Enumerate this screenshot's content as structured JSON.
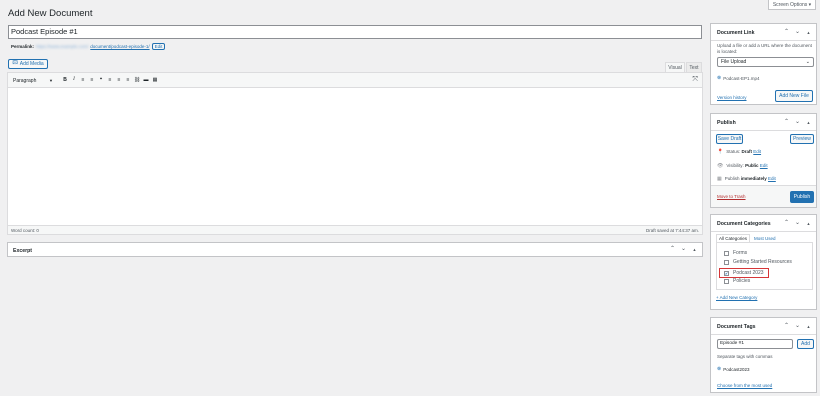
{
  "page_title": "Add New Document",
  "screen_options": "Screen Options ▾",
  "title_value": "Podcast Episode #1",
  "permalink": {
    "label": "Permalink:",
    "url_blur": "https://www.example.com/",
    "url_slug": "document/podcast-episode-1/",
    "edit": "Edit"
  },
  "editor": {
    "add_media": "Add Media",
    "tab_visual": "Visual",
    "tab_text": "Text",
    "format_select": "Paragraph",
    "toolbar": [
      "B",
      "I",
      "≡",
      "≡",
      "❝",
      "≡",
      "≡",
      "≡",
      "⛓",
      "▬",
      "▦"
    ],
    "word_count": "Word count: 0",
    "draft_saved": "Draft saved at 7:44:37 am."
  },
  "excerpt": {
    "title": "Excerpt"
  },
  "document_link": {
    "title": "Document Link",
    "description": "Upload a file or add a URL where the document is located:",
    "select_value": "File Upload",
    "file_name": "Podcast-EP1.mp4",
    "version_history": "Version history",
    "add_new_file": "Add New File"
  },
  "publish": {
    "title": "Publish",
    "save_draft": "Save Draft",
    "preview": "Preview",
    "status_label": "Status:",
    "status_value": "Draft",
    "visibility_label": "Visibility:",
    "visibility_value": "Public",
    "publish_label": "Publish",
    "publish_value": "immediately",
    "edit": "Edit",
    "move_to_trash": "Move to Trash",
    "publish_button": "Publish"
  },
  "categories": {
    "title": "Document Categories",
    "tab_all": "All Categories",
    "tab_most_used": "Most Used",
    "items": [
      {
        "label": "Forms",
        "checked": false
      },
      {
        "label": "Getting Started Resources",
        "checked": false
      },
      {
        "label": "Podcast 2023",
        "checked": true
      },
      {
        "label": "Policies",
        "checked": false
      }
    ],
    "add_new": "+ Add New Category"
  },
  "tags": {
    "title": "Document Tags",
    "input_value": "Episode #1",
    "add": "Add",
    "help": "Separate tags with commas",
    "tag": "Podcast2023",
    "choose": "Choose from the most used"
  },
  "colors": {
    "accent": "#2271b1",
    "highlight": "#d63638"
  }
}
